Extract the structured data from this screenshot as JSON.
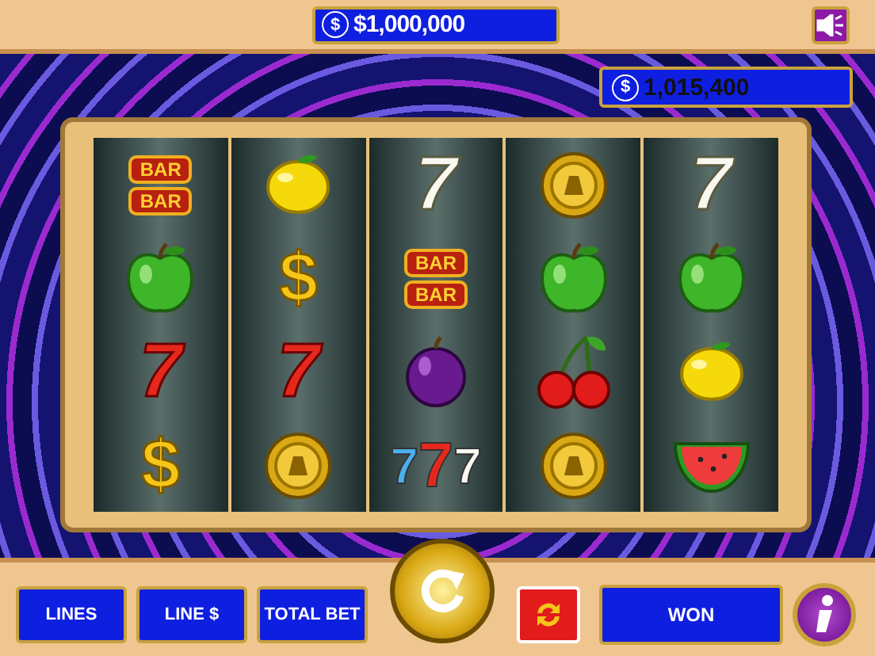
{
  "jackpot": {
    "currency_symbol": "$",
    "amount": "$1,000,000"
  },
  "balance": {
    "currency_symbol": "$",
    "amount": "1,015,400"
  },
  "reels": [
    {
      "symbols": [
        {
          "kind": "bar",
          "text": [
            "BAR",
            "BAR"
          ]
        },
        {
          "kind": "apple"
        },
        {
          "kind": "red-seven",
          "text": [
            "7"
          ]
        },
        {
          "kind": "dollar",
          "text": [
            "$"
          ]
        }
      ]
    },
    {
      "symbols": [
        {
          "kind": "lemon"
        },
        {
          "kind": "dollar",
          "text": [
            "$"
          ]
        },
        {
          "kind": "red-seven",
          "text": [
            "7"
          ]
        },
        {
          "kind": "coin"
        }
      ]
    },
    {
      "symbols": [
        {
          "kind": "white-seven",
          "text": [
            "7"
          ]
        },
        {
          "kind": "bar",
          "text": [
            "BAR",
            "BAR"
          ]
        },
        {
          "kind": "plum"
        },
        {
          "kind": "triple-seven",
          "text": [
            "7",
            "7",
            "7"
          ]
        }
      ]
    },
    {
      "symbols": [
        {
          "kind": "coin"
        },
        {
          "kind": "apple"
        },
        {
          "kind": "cherry"
        },
        {
          "kind": "coin"
        }
      ]
    },
    {
      "symbols": [
        {
          "kind": "white-seven",
          "text": [
            "7"
          ]
        },
        {
          "kind": "apple"
        },
        {
          "kind": "lemon"
        },
        {
          "kind": "watermelon"
        }
      ]
    }
  ],
  "controls": [
    {
      "label": "LINES"
    },
    {
      "label": "LINE $"
    },
    {
      "label": "TOTAL BET"
    }
  ],
  "won": {
    "label": "WON"
  }
}
